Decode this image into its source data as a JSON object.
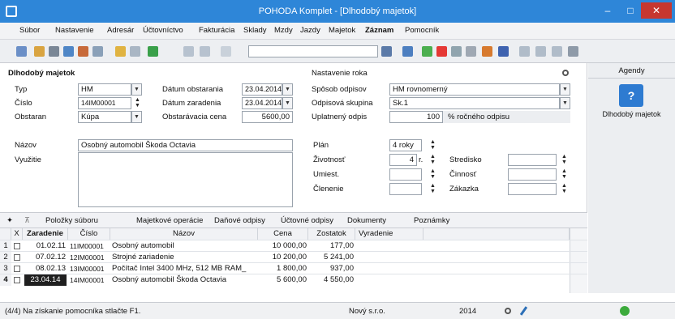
{
  "window": {
    "title": "POHODA Komplet - [Dlhodobý majetok]",
    "minimize": "‒",
    "maximize": "□",
    "close": "✕"
  },
  "menu": [
    "Súbor",
    "Nastavenie",
    "Adresár",
    "Účtovníctvo",
    "Fakturácia",
    "Sklady",
    "Mzdy",
    "Jazdy",
    "Majetok",
    "Záznam",
    "Pomocník"
  ],
  "form": {
    "section_title": "Dlhodobý majetok",
    "settings_title": "Nastavenie roka",
    "typ": {
      "label": "Typ",
      "value": "HM"
    },
    "cislo": {
      "label": "Číslo",
      "value": "14IM00001"
    },
    "obstaran": {
      "label": "Obstaran",
      "value": "Kúpa"
    },
    "datum_obstarania": {
      "label": "Dátum obstarania",
      "value": "23.04.2014"
    },
    "datum_zaradenia": {
      "label": "Dátum zaradenia",
      "value": "23.04.2014"
    },
    "obstaravacia_cena": {
      "label": "Obstarávacia cena",
      "value": "5600,00"
    },
    "sposob_odpisov": {
      "label": "Spôsob odpisov",
      "value": "HM rovnomerný"
    },
    "odpisova_skupina": {
      "label": "Odpisová skupina",
      "value": "Sk.1"
    },
    "uplatneny_odpis": {
      "label": "Uplatnený odpis",
      "value": "100",
      "suffix": "% ročného odpisu"
    },
    "nazov": {
      "label": "Názov",
      "value": "Osobný automobil Škoda Octavia"
    },
    "vyuzitie": {
      "label": "Využitie",
      "value": ""
    },
    "plan": {
      "label": "Plán",
      "value": "4 roky"
    },
    "zivotnost": {
      "label": "Životnosť",
      "value": "4",
      "unit": "r."
    },
    "umiest": {
      "label": "Umiest.",
      "value": ""
    },
    "clenenie": {
      "label": "Členenie",
      "value": ""
    },
    "stredisko": {
      "label": "Stredisko",
      "value": ""
    },
    "cinnost": {
      "label": "Činnosť",
      "value": ""
    },
    "zakazka": {
      "label": "Zákazka",
      "value": ""
    }
  },
  "agendy": {
    "title": "Agendy",
    "item": "Dlhodobý majetok"
  },
  "tabs": [
    "Položky súboru",
    "Majetkové operácie",
    "Daňové odpisy",
    "Účtovné odpisy",
    "Dokumenty",
    "Poznámky"
  ],
  "table": {
    "columns": [
      "X",
      "Zaradenie",
      "Číslo",
      "Názov",
      "Cena",
      "Zostatok",
      "Vyradenie"
    ],
    "rows": [
      {
        "n": "1",
        "zaradenie": "01.02.11",
        "cislo": "11IM00001",
        "nazov": "Osobný automobil",
        "cena": "10 000,00",
        "zostatok": "177,00",
        "vyradenie": ""
      },
      {
        "n": "2",
        "zaradenie": "07.02.12",
        "cislo": "12IM00001",
        "nazov": "Strojné zariadenie",
        "cena": "10 200,00",
        "zostatok": "5 241,00",
        "vyradenie": ""
      },
      {
        "n": "3",
        "zaradenie": "08.02.13",
        "cislo": "13IM00001",
        "nazov": "Počítač Intel 3400 MHz, 512 MB RAM_",
        "cena": "1 800,00",
        "zostatok": "937,00",
        "vyradenie": ""
      },
      {
        "n": "4",
        "zaradenie": "23.04.14",
        "cislo": "14IM00001",
        "nazov": "Osobný automobil Škoda Octavia",
        "cena": "5 600,00",
        "zostatok": "4 550,00",
        "vyradenie": ""
      }
    ]
  },
  "status": {
    "hint": "(4/4) Na získanie pomocníka stlačte F1.",
    "company": "Nový s.r.o.",
    "year": "2014"
  },
  "colors": {
    "titlebar": "#2e86d8",
    "close": "#c7372f",
    "selected": "#1f1f1f"
  }
}
